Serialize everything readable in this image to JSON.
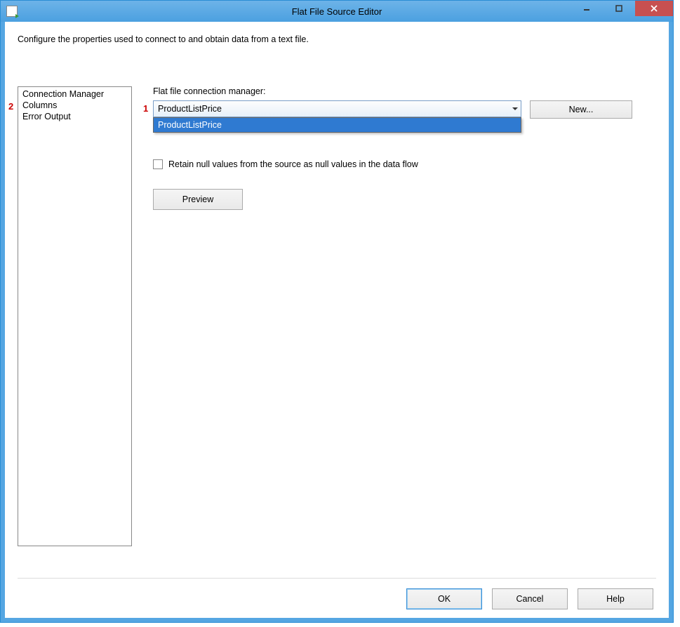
{
  "window": {
    "title": "Flat File Source Editor"
  },
  "description": "Configure the properties used to connect to and obtain data from a text file.",
  "nav": {
    "items": [
      {
        "label": "Connection Manager"
      },
      {
        "label": "Columns"
      },
      {
        "label": "Error Output"
      }
    ]
  },
  "annotations": {
    "marker1": "1",
    "marker2": "2"
  },
  "main": {
    "connection_label": "Flat file connection manager:",
    "connection_selected": "ProductListPrice",
    "connection_options": [
      "ProductListPrice"
    ],
    "new_button": "New...",
    "retain_null_label": "Retain null values from the source as null values in the data flow",
    "retain_null_checked": false,
    "preview_button": "Preview"
  },
  "footer": {
    "ok": "OK",
    "cancel": "Cancel",
    "help": "Help"
  }
}
